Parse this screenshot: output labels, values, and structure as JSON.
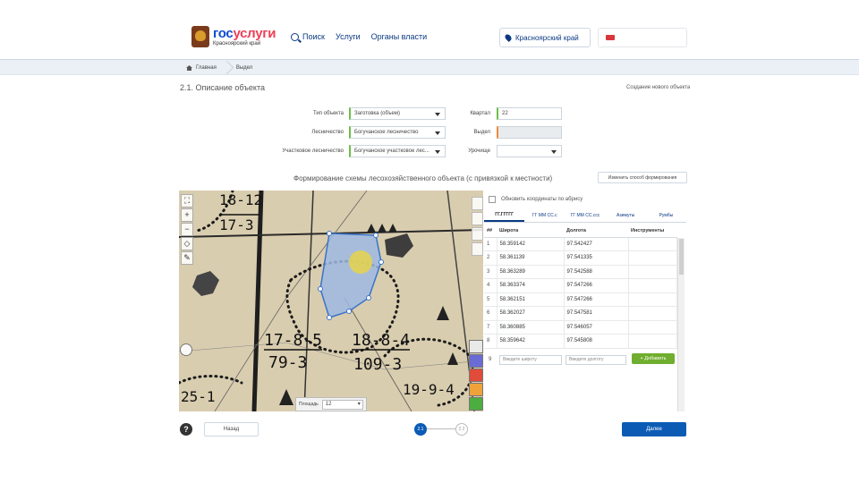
{
  "header": {
    "logo_part1": "гос",
    "logo_part2": "услуги",
    "logo_sub": "Красноярский край",
    "nav": [
      "Поиск",
      "Услуги",
      "Органы власти"
    ],
    "region": "Красноярский край"
  },
  "breadcrumb": {
    "home": "Главная",
    "current": "Выдел"
  },
  "section": {
    "title": "2.1. Описание объекта",
    "new_object_link": "Создание нового объекта"
  },
  "form": {
    "object_type_label": "Тип объекта",
    "object_type_value": "Заготовка (объем)",
    "forestry_label": "Лесничество",
    "forestry_value": "Богучанское лесничество",
    "district_forestry_label": "Участковое лесничество",
    "district_forestry_value": "Богучанское участковое лес...",
    "quarter_label": "Квартал",
    "quarter_value": "22",
    "plot_label": "Выдел",
    "plot_value": "",
    "tract_label": "Урочище",
    "tract_value": ""
  },
  "scheme": {
    "title": "Формирование схемы лесохозяйственного объекта (с привязкой к местности)",
    "change_mode_button": "Изменить способ формирования"
  },
  "map": {
    "tools": [
      "⛶",
      "+",
      "−",
      "◇",
      "✎"
    ],
    "labels": [
      "18-12",
      "17-3",
      "17-8-5",
      "79-3",
      "18-8-4",
      "109-3",
      "19-9-4",
      "25-1"
    ],
    "opacity_label": "Площадь",
    "opacity_value": "12"
  },
  "coords_panel": {
    "refresh_label": "Обновить координаты по абрису",
    "tabs": [
      "ГГ.ГГГГГ",
      "ГГ ММ СС.с",
      "ГГ ММ СС.ссс",
      "Азимуты",
      "Румбы"
    ],
    "columns": [
      "##",
      "Широта",
      "Долгота",
      "Инструменты"
    ],
    "rows": [
      {
        "n": "1",
        "lat": "58.359142",
        "lon": "97.542427"
      },
      {
        "n": "2",
        "lat": "58.361139",
        "lon": "97.541335"
      },
      {
        "n": "3",
        "lat": "58.363289",
        "lon": "97.542588"
      },
      {
        "n": "4",
        "lat": "58.363374",
        "lon": "97.547266"
      },
      {
        "n": "5",
        "lat": "58.362151",
        "lon": "97.547266"
      },
      {
        "n": "6",
        "lat": "58.362027",
        "lon": "97.547581"
      },
      {
        "n": "7",
        "lat": "58.360885",
        "lon": "97.546057"
      },
      {
        "n": "8",
        "lat": "58.359642",
        "lon": "97.545808"
      }
    ],
    "new_row_number": "9",
    "lat_placeholder": "Введите широту",
    "lon_placeholder": "Введите долготу",
    "add_button": "+ Добавить"
  },
  "footer": {
    "help": "?",
    "back_button": "Назад",
    "step1": "2.1",
    "step2": "2.2",
    "next_button": "Далее"
  },
  "colors": {
    "brand_blue": "#0b5bb5",
    "accent_green": "#6fae2e",
    "polygon_fill": "#9db9e3"
  }
}
